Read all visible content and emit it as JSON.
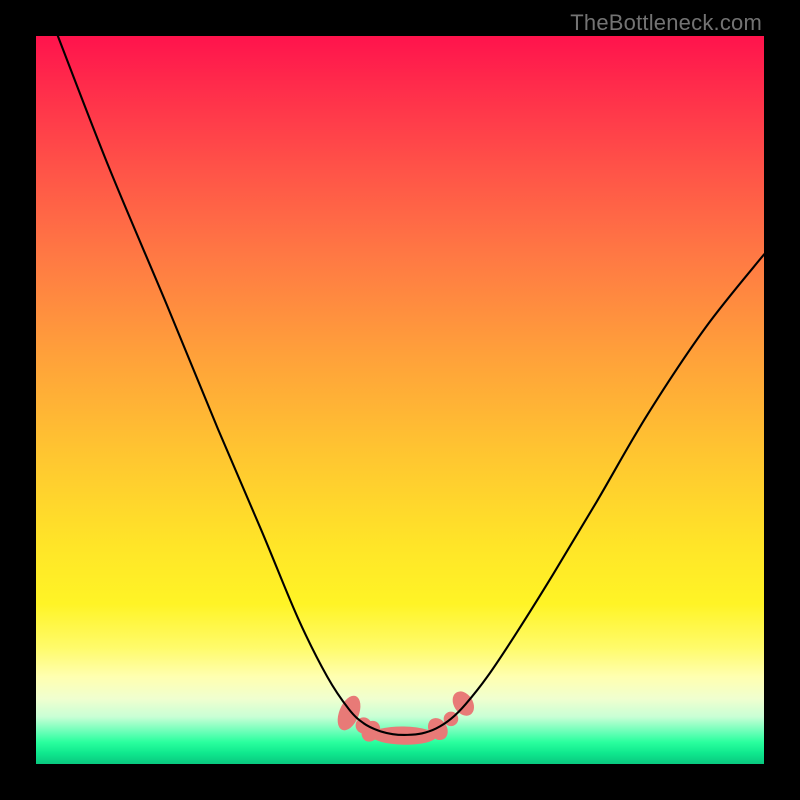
{
  "watermark": "TheBottleneck.com",
  "chart_data": {
    "type": "line",
    "title": "",
    "xlabel": "",
    "ylabel": "",
    "xlim": [
      0,
      100
    ],
    "ylim": [
      0,
      100
    ],
    "grid": false,
    "curve_points": [
      [
        3,
        100
      ],
      [
        10,
        82
      ],
      [
        18,
        63
      ],
      [
        25,
        46
      ],
      [
        31,
        32
      ],
      [
        36,
        20
      ],
      [
        40,
        12
      ],
      [
        43,
        7.5
      ],
      [
        45,
        5.6
      ],
      [
        47,
        4.6
      ],
      [
        49,
        4.1
      ],
      [
        51,
        4.0
      ],
      [
        53,
        4.2
      ],
      [
        55,
        4.9
      ],
      [
        57,
        6.2
      ],
      [
        59,
        8.2
      ],
      [
        62,
        12
      ],
      [
        66,
        18
      ],
      [
        71,
        26
      ],
      [
        77,
        36
      ],
      [
        84,
        48
      ],
      [
        92,
        60
      ],
      [
        100,
        70
      ]
    ],
    "blobs": {
      "color": "#e87a77",
      "items": [
        {
          "cx": 43.0,
          "cy": 7.0,
          "rx": 1.35,
          "ry": 2.5,
          "rot": 22
        },
        {
          "cx": 45.0,
          "cy": 5.3,
          "rx": 1.1,
          "ry": 1.1,
          "rot": 0
        },
        {
          "cx": 46.0,
          "cy": 4.5,
          "rx": 1.2,
          "ry": 1.5,
          "rot": 30
        },
        {
          "cx": 50.5,
          "cy": 3.9,
          "rx": 4.5,
          "ry": 1.25,
          "rot": 1
        },
        {
          "cx": 55.2,
          "cy": 4.8,
          "rx": 1.25,
          "ry": 1.6,
          "rot": -32
        },
        {
          "cx": 57.0,
          "cy": 6.2,
          "rx": 1.0,
          "ry": 1.0,
          "rot": 0
        },
        {
          "cx": 58.7,
          "cy": 8.3,
          "rx": 1.3,
          "ry": 1.8,
          "rot": -33
        }
      ]
    }
  }
}
